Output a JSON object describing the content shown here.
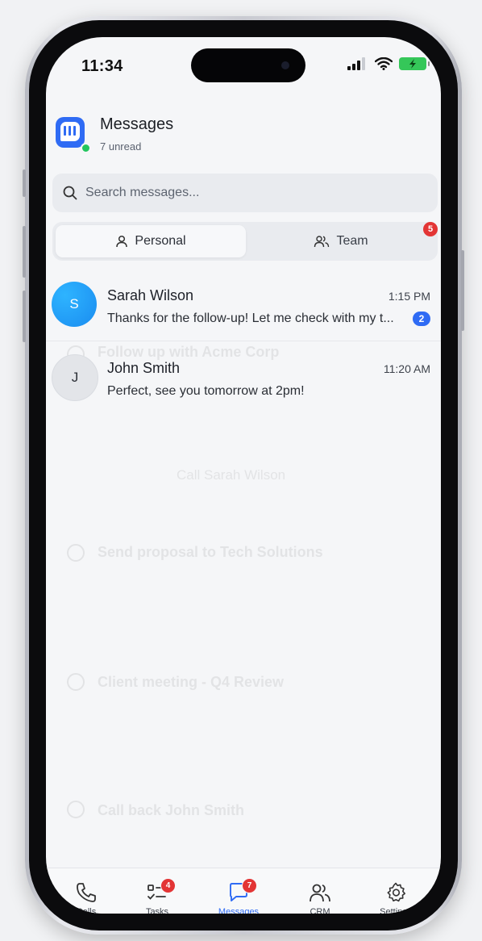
{
  "status_bar": {
    "time": "11:34"
  },
  "header": {
    "title": "Messages",
    "subtitle": "7 unread"
  },
  "search": {
    "placeholder": "Search messages..."
  },
  "tabs": [
    {
      "label": "Personal",
      "icon": "person-icon",
      "active": true
    },
    {
      "label": "Team",
      "icon": "people-icon",
      "active": false,
      "badge": "5"
    }
  ],
  "conversations": [
    {
      "avatar": "S",
      "name": "Sarah Wilson",
      "time": "1:15 PM",
      "message": "Thanks for the follow-up! Let me check with my t...",
      "unread": "2",
      "avatar_color": "#1a8cf0"
    },
    {
      "avatar": "J",
      "name": "John Smith",
      "time": "11:20 AM",
      "message": "Perfect, see you tomorrow at 2pm!"
    }
  ],
  "background_ghost": {
    "items": [
      "Follow up with Acme Corp",
      "Call Sarah Wilson",
      "Send proposal to Tech Solutions",
      "Client meeting - Q4 Review",
      "Call back John Smith"
    ]
  },
  "bottom_nav": [
    {
      "label": "Calls",
      "icon": "phone-icon"
    },
    {
      "label": "Tasks",
      "icon": "checklist-icon",
      "badge": "4"
    },
    {
      "label": "Messages",
      "icon": "chat-icon",
      "badge": "7",
      "active": true
    },
    {
      "label": "CRM",
      "icon": "users-icon"
    },
    {
      "label": "Settings",
      "icon": "gear-icon"
    }
  ],
  "colors": {
    "accent": "#2f6bf4",
    "badge_red": "#e33535",
    "online": "#22c55e"
  }
}
